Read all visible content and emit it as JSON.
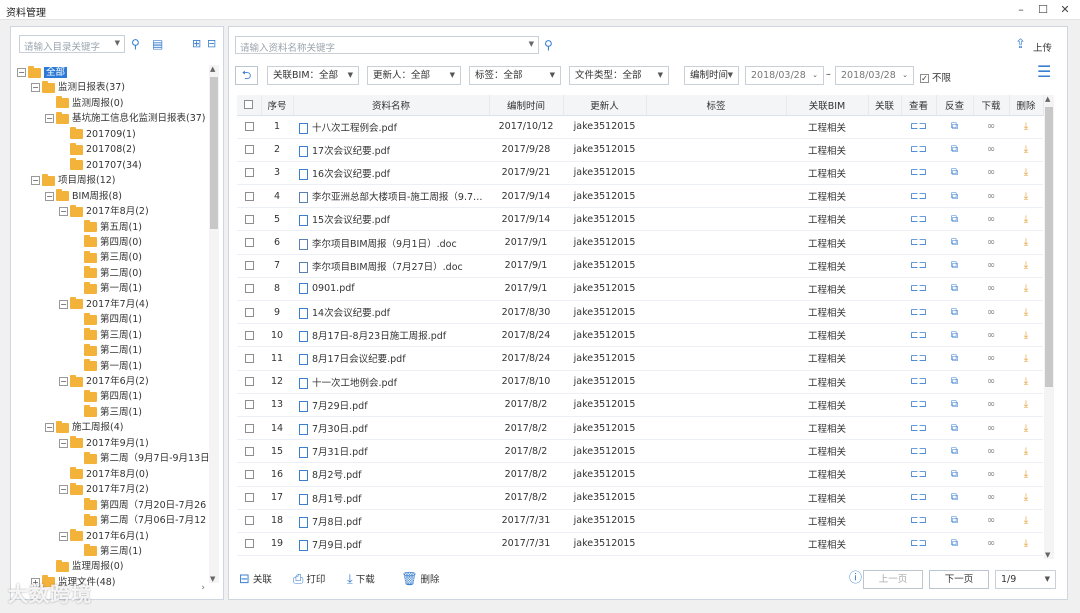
{
  "window": {
    "title": "资料管理",
    "min": "–",
    "max": "☐",
    "close": "✕"
  },
  "left": {
    "search_placeholder": "请输入目录关键字",
    "tree": [
      {
        "label": "全部",
        "depth": 0,
        "toggle": "−",
        "selected": true
      },
      {
        "label": "监测日报表(37)",
        "depth": 1,
        "toggle": "−"
      },
      {
        "label": "监测周报(0)",
        "depth": 2,
        "toggle": ""
      },
      {
        "label": "基坑施工信息化监测日报表(37)",
        "depth": 2,
        "toggle": "−"
      },
      {
        "label": "201709(1)",
        "depth": 3,
        "toggle": ""
      },
      {
        "label": "201708(2)",
        "depth": 3,
        "toggle": ""
      },
      {
        "label": "201707(34)",
        "depth": 3,
        "toggle": ""
      },
      {
        "label": "项目周报(12)",
        "depth": 1,
        "toggle": "−"
      },
      {
        "label": "BIM周报(8)",
        "depth": 2,
        "toggle": "−"
      },
      {
        "label": "2017年8月(2)",
        "depth": 3,
        "toggle": "−"
      },
      {
        "label": "第五周(1)",
        "depth": 4,
        "toggle": ""
      },
      {
        "label": "第四周(0)",
        "depth": 4,
        "toggle": ""
      },
      {
        "label": "第三周(0)",
        "depth": 4,
        "toggle": ""
      },
      {
        "label": "第二周(0)",
        "depth": 4,
        "toggle": ""
      },
      {
        "label": "第一周(1)",
        "depth": 4,
        "toggle": ""
      },
      {
        "label": "2017年7月(4)",
        "depth": 3,
        "toggle": "−"
      },
      {
        "label": "第四周(1)",
        "depth": 4,
        "toggle": ""
      },
      {
        "label": "第三周(1)",
        "depth": 4,
        "toggle": ""
      },
      {
        "label": "第二周(1)",
        "depth": 4,
        "toggle": ""
      },
      {
        "label": "第一周(1)",
        "depth": 4,
        "toggle": ""
      },
      {
        "label": "2017年6月(2)",
        "depth": 3,
        "toggle": "−"
      },
      {
        "label": "第四周(1)",
        "depth": 4,
        "toggle": ""
      },
      {
        "label": "第三周(1)",
        "depth": 4,
        "toggle": ""
      },
      {
        "label": "施工周报(4)",
        "depth": 2,
        "toggle": "−"
      },
      {
        "label": "2017年9月(1)",
        "depth": 3,
        "toggle": "−"
      },
      {
        "label": "第二周（9月7日-9月13日",
        "depth": 4,
        "toggle": ""
      },
      {
        "label": "2017年8月(0)",
        "depth": 3,
        "toggle": ""
      },
      {
        "label": "2017年7月(2)",
        "depth": 3,
        "toggle": "−"
      },
      {
        "label": "第四周（7月20日-7月26",
        "depth": 4,
        "toggle": ""
      },
      {
        "label": "第二周（7月06日-7月12",
        "depth": 4,
        "toggle": ""
      },
      {
        "label": "2017年6月(1)",
        "depth": 3,
        "toggle": "−"
      },
      {
        "label": "第三周(1)",
        "depth": 4,
        "toggle": ""
      },
      {
        "label": "监理周报(0)",
        "depth": 2,
        "toggle": ""
      },
      {
        "label": "监理文件(48)",
        "depth": 1,
        "toggle": "+"
      }
    ]
  },
  "right": {
    "search_placeholder": "请输入资料名称关键字",
    "upload_label": "上传",
    "filters": {
      "bim": "关联BIM：全部",
      "updater": "更新人：全部",
      "tag": "标签：全部",
      "filetype": "文件类型：全部",
      "time_field": "编制时间",
      "date_from": "2018/03/28",
      "date_to": "2018/03/28",
      "date_sep": "–",
      "unlimited": "不限"
    },
    "columns": [
      "序号",
      "资料名称",
      "编制时间",
      "更新人",
      "标签",
      "关联BIM",
      "关联",
      "查看",
      "反查",
      "下载",
      "删除"
    ],
    "rows": [
      {
        "n": "1",
        "name": "十八次工程例会.pdf",
        "type": "pdf",
        "date": "2017/10/12",
        "user": "jake3512015",
        "tag": "",
        "bim": "工程相关"
      },
      {
        "n": "2",
        "name": "17次会议纪要.pdf",
        "type": "pdf",
        "date": "2017/9/28",
        "user": "jake3512015",
        "tag": "",
        "bim": "工程相关"
      },
      {
        "n": "3",
        "name": "16次会议纪要.pdf",
        "type": "pdf",
        "date": "2017/9/21",
        "user": "jake3512015",
        "tag": "",
        "bim": "工程相关"
      },
      {
        "n": "4",
        "name": "李尔亚洲总部大楼项目-施工周报（9.7~9....",
        "type": "doc",
        "date": "2017/9/14",
        "user": "jake3512015",
        "tag": "",
        "bim": "工程相关"
      },
      {
        "n": "5",
        "name": "15次会议纪要.pdf",
        "type": "pdf",
        "date": "2017/9/14",
        "user": "jake3512015",
        "tag": "",
        "bim": "工程相关"
      },
      {
        "n": "6",
        "name": "李尔项目BIM周报（9月1日）.doc",
        "type": "doc",
        "date": "2017/9/1",
        "user": "jake3512015",
        "tag": "",
        "bim": "工程相关"
      },
      {
        "n": "7",
        "name": "李尔项目BIM周报（7月27日）.doc",
        "type": "doc",
        "date": "2017/9/1",
        "user": "jake3512015",
        "tag": "",
        "bim": "工程相关"
      },
      {
        "n": "8",
        "name": "0901.pdf",
        "type": "pdf",
        "date": "2017/9/1",
        "user": "jake3512015",
        "tag": "",
        "bim": "工程相关"
      },
      {
        "n": "9",
        "name": "14次会议纪要.pdf",
        "type": "pdf",
        "date": "2017/8/30",
        "user": "jake3512015",
        "tag": "",
        "bim": "工程相关"
      },
      {
        "n": "10",
        "name": "8月17日-8月23日施工周报.pdf",
        "type": "pdf",
        "date": "2017/8/24",
        "user": "jake3512015",
        "tag": "",
        "bim": "工程相关"
      },
      {
        "n": "11",
        "name": "8月17日会议纪要.pdf",
        "type": "pdf",
        "date": "2017/8/24",
        "user": "jake3512015",
        "tag": "",
        "bim": "工程相关"
      },
      {
        "n": "12",
        "name": "十一次工地例会.pdf",
        "type": "pdf",
        "date": "2017/8/10",
        "user": "jake3512015",
        "tag": "",
        "bim": "工程相关"
      },
      {
        "n": "13",
        "name": "7月29日.pdf",
        "type": "pdf",
        "date": "2017/8/2",
        "user": "jake3512015",
        "tag": "",
        "bim": "工程相关"
      },
      {
        "n": "14",
        "name": "7月30日.pdf",
        "type": "pdf",
        "date": "2017/8/2",
        "user": "jake3512015",
        "tag": "",
        "bim": "工程相关"
      },
      {
        "n": "15",
        "name": "7月31日.pdf",
        "type": "pdf",
        "date": "2017/8/2",
        "user": "jake3512015",
        "tag": "",
        "bim": "工程相关"
      },
      {
        "n": "16",
        "name": "8月2号.pdf",
        "type": "pdf",
        "date": "2017/8/2",
        "user": "jake3512015",
        "tag": "",
        "bim": "工程相关"
      },
      {
        "n": "17",
        "name": "8月1号.pdf",
        "type": "pdf",
        "date": "2017/8/2",
        "user": "jake3512015",
        "tag": "",
        "bim": "工程相关"
      },
      {
        "n": "18",
        "name": "7月8日.pdf",
        "type": "pdf",
        "date": "2017/7/31",
        "user": "jake3512015",
        "tag": "",
        "bim": "工程相关"
      },
      {
        "n": "19",
        "name": "7月9日.pdf",
        "type": "pdf",
        "date": "2017/7/31",
        "user": "jake3512015",
        "tag": "",
        "bim": "工程相关"
      }
    ],
    "bottom": {
      "link": "关联",
      "print": "打印",
      "download": "下载",
      "delete": "删除",
      "prev": "上一页",
      "next": "下一页",
      "page": "1/9"
    }
  },
  "watermark": "大数跨境",
  "colors": {
    "accent": "#3a7fd0",
    "folder": "#f3b23a",
    "selected": "#2c7ad6"
  }
}
